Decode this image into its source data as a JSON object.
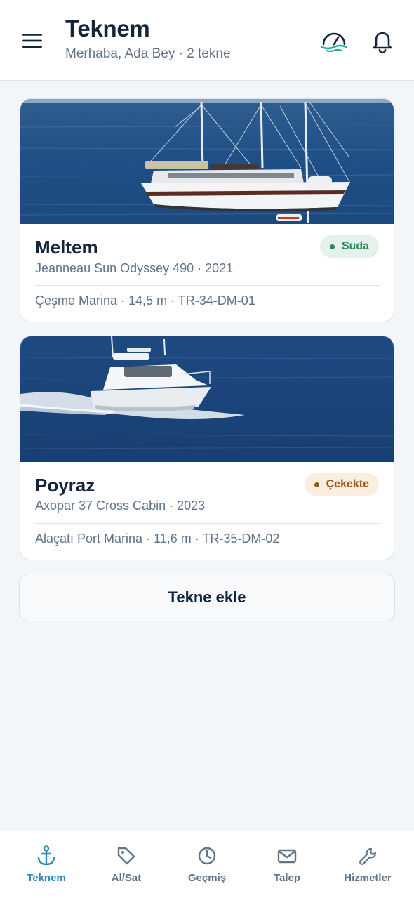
{
  "header": {
    "title": "Teknem",
    "subtitle": "Merhaba, Ada Bey · 2 tekne",
    "icons": [
      "menu-icon",
      "gauge-icon",
      "bell-icon"
    ]
  },
  "boats": [
    {
      "name": "Meltem",
      "model": "Jeanneau Sun Odyssey 490 · 2021",
      "meta": "Çeşme Marina · 14,5 m · TR-34-DM-01",
      "status": "Suda",
      "status_color": "#2b8a57"
    },
    {
      "name": "Poyraz",
      "model": "Axopar 37 Cross Cabin · 2023",
      "meta": "Alaçatı Port Marina · 11,6 m · TR-35-DM-02",
      "status": "Çekekte",
      "status_color": "#9a5a14"
    }
  ],
  "add_button": "Tekne ekle",
  "tabs": [
    {
      "label": "Teknem",
      "icon": "anchor-icon",
      "active": true
    },
    {
      "label": "Al/Sat",
      "icon": "tag-icon",
      "active": false
    },
    {
      "label": "Geçmiş",
      "icon": "clock-icon",
      "active": false
    },
    {
      "label": "Talep",
      "icon": "mail-icon",
      "active": false
    },
    {
      "label": "Hizmetler",
      "icon": "wrench-icon",
      "active": false
    }
  ],
  "colors": {
    "accent": "#2f88b6",
    "text": "#14243b",
    "muted": "#5f7389",
    "background": "#f3f6f9"
  }
}
